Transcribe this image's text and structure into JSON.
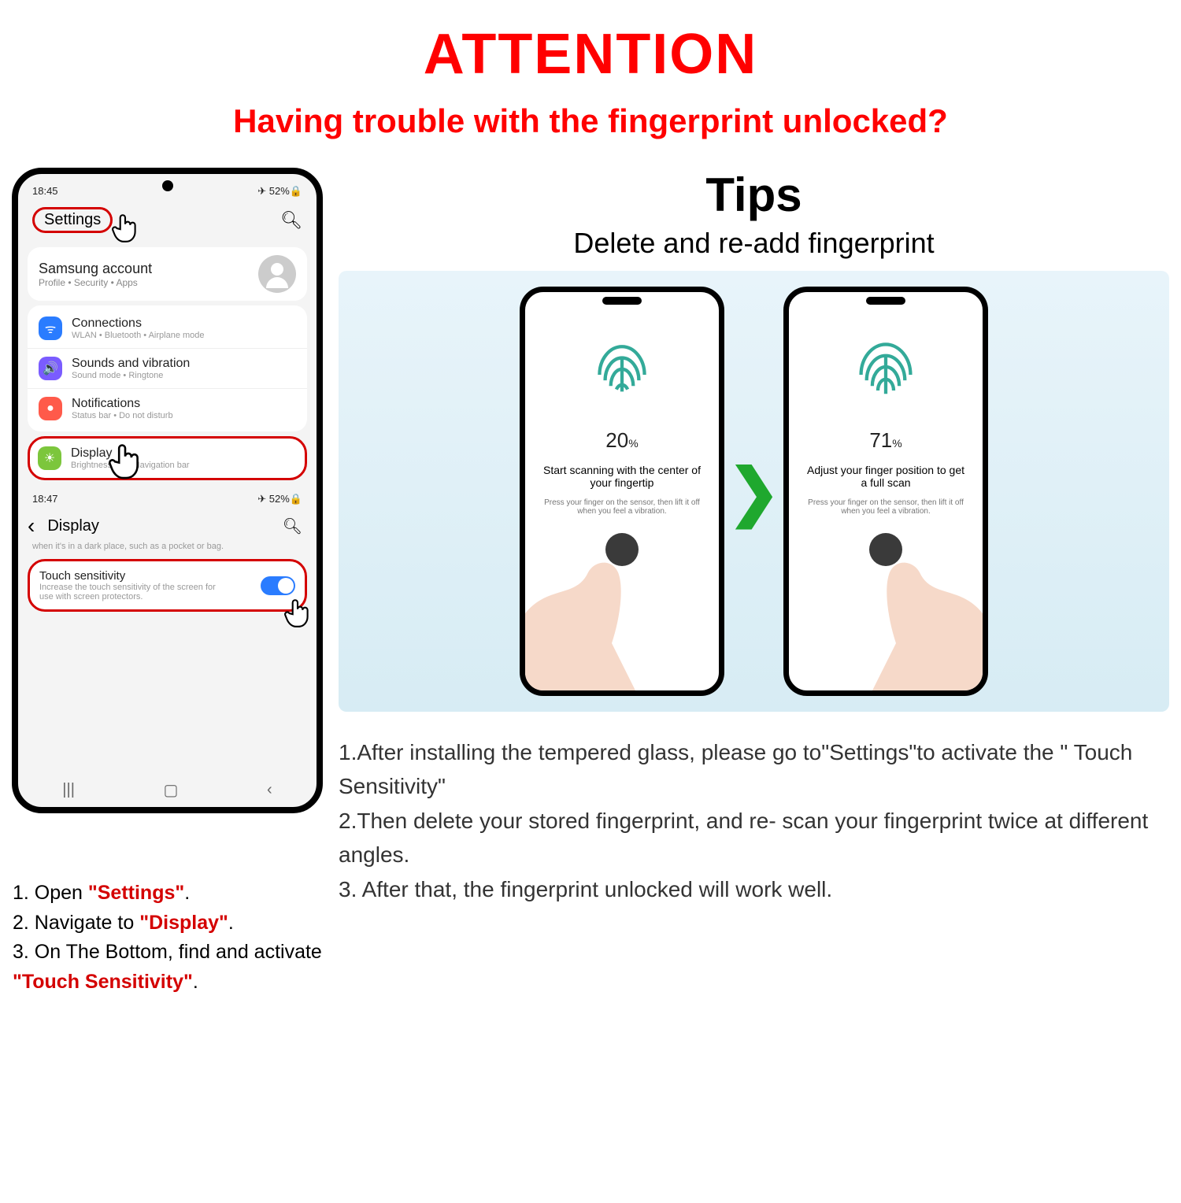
{
  "header": {
    "title": "ATTENTION",
    "subtitle": "Having trouble with the fingerprint unlocked?"
  },
  "phone1": {
    "time": "18:45",
    "indicators": "✈ 52%🔒",
    "settings_label": "Settings",
    "account": {
      "title": "Samsung account",
      "sub": "Profile  •  Security  •  Apps"
    },
    "items": [
      {
        "icon_bg": "#2a7cff",
        "glyph": "ᯤ",
        "title": "Connections",
        "sub": "WLAN  •  Bluetooth  •  Airplane mode"
      },
      {
        "icon_bg": "#7a5cff",
        "glyph": "🔊",
        "title": "Sounds and vibration",
        "sub": "Sound mode  •  Ringtone"
      },
      {
        "icon_bg": "#ff5a4a",
        "glyph": "●",
        "title": "Notifications",
        "sub": "Status bar  •  Do not disturb"
      }
    ],
    "display": {
      "icon_bg": "#7cc63c",
      "glyph": "☀",
      "title": "Display",
      "sub": "Brightness                    eld  •  Navigation bar"
    }
  },
  "phone1b": {
    "time": "18:47",
    "indicators": "✈ 52%🔒",
    "back_glyph": "‹",
    "title": "Display",
    "truncated": "when it's in a dark place, such as a pocket or bag.",
    "touch": {
      "title": "Touch sensitivity",
      "sub": "Increase the touch sensitivity of the screen for use with screen protectors."
    },
    "nav_glyphs": [
      "|||",
      "▢",
      "‹"
    ]
  },
  "tips": {
    "heading": "Tips",
    "sub": "Delete and re-add fingerprint"
  },
  "scan": {
    "left": {
      "pct": "20",
      "unit": "%",
      "l1": "Start scanning with the center of your fingertip",
      "l2": "Press your finger on the sensor, then lift it off when you feel a vibration."
    },
    "arrow": "❯",
    "right": {
      "pct": "71",
      "unit": "%",
      "l1": "Adjust your finger position to get a full scan",
      "l2": "Press your finger on the sensor, then lift it off when you feel a vibration."
    }
  },
  "left_steps": [
    {
      "n": "1. Open ",
      "red": "\"Settings\"",
      "tail": "."
    },
    {
      "n": "2. Navigate to ",
      "red": "\"Display\"",
      "tail": "."
    },
    {
      "n": "3. On The Bottom, find and activate ",
      "red": "\"Touch Sensitivity\"",
      "tail": "."
    }
  ],
  "right_steps": [
    "1.After installing the tempered glass, please go to\"Settings\"to activate the \" Touch Sensitivity\"",
    "2.Then delete your stored fingerprint, and re- scan your fingerprint twice at different angles.",
    "3. After that, the fingerprint unlocked will work well."
  ]
}
